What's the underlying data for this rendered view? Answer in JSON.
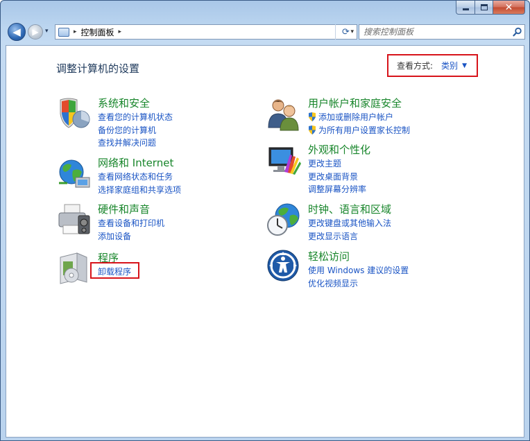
{
  "window": {
    "close_glyph": "✕"
  },
  "navbar": {
    "back_glyph": "◀",
    "forward_glyph": "▶",
    "recent_glyph": "▾",
    "address_sep": "▸",
    "address_path": "控制面板",
    "address_sep2": "▸",
    "address_dropdown": "▾",
    "refresh_glyph": "⟳",
    "search_placeholder": "搜索控制面板"
  },
  "content": {
    "title": "调整计算机的设置",
    "view_by": {
      "label": "查看方式:",
      "value": "类别",
      "arrow": "▼"
    },
    "categories": [
      {
        "icon": "security-shield-icon",
        "title": "系统和安全",
        "links": [
          "查看您的计算机状态",
          "备份您的计算机",
          "查找并解决问题"
        ]
      },
      {
        "icon": "network-globe-icon",
        "title": "网络和 Internet",
        "links": [
          "查看网络状态和任务",
          "选择家庭组和共享选项"
        ]
      },
      {
        "icon": "printer-icon",
        "title": "硬件和声音",
        "links": [
          "查看设备和打印机",
          "添加设备"
        ]
      },
      {
        "icon": "programs-box-icon",
        "title": "程序",
        "links": [
          "卸载程序"
        ]
      },
      {
        "icon": "users-icon",
        "title": "用户帐户和家庭安全",
        "links": [
          "添加或删除用户帐户",
          "为所有用户设置家长控制"
        ]
      },
      {
        "icon": "appearance-monitor-icon",
        "title": "外观和个性化",
        "links": [
          "更改主题",
          "更改桌面背景",
          "调整屏幕分辨率"
        ]
      },
      {
        "icon": "clock-globe-icon",
        "title": "时钟、语言和区域",
        "links": [
          "更改键盘或其他输入法",
          "更改显示语言"
        ]
      },
      {
        "icon": "ease-of-access-icon",
        "title": "轻松访问",
        "links": [
          "使用 Windows 建议的设置",
          "优化视频显示"
        ]
      }
    ]
  },
  "colors": {
    "link": "#1a54c4",
    "category_title": "#17852a",
    "highlight_border": "#d7131a"
  }
}
